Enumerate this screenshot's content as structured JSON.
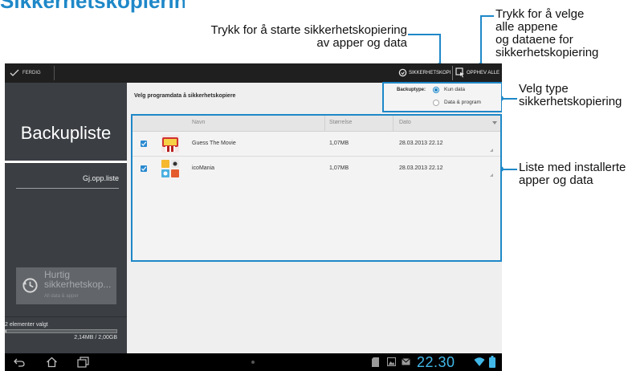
{
  "page": {
    "heading_fragment": "Sikkerhetskopiering"
  },
  "callouts": {
    "start_backup": [
      "Trykk for å starte sikkerhetskopiering",
      "av apper og data"
    ],
    "select_all": [
      "Trykk for å velge",
      "alle appene",
      "og dataene for",
      "sikkerhetskopiering"
    ],
    "backup_type": [
      "Velg type",
      "sikkerhetskopiering"
    ],
    "app_list": [
      "Liste med installerte",
      "apper og data"
    ]
  },
  "actionbar": {
    "done_label": "FERDIG",
    "backup_label": "SIKKERHETSKOPI",
    "deselect_label": "OPPHEV ALLE"
  },
  "sidebar": {
    "title": "Backupliste",
    "restore_link": "Gj.opp.liste",
    "quick_backup_title_1": "Hurtig",
    "quick_backup_title_2": "sikkerhetskop...",
    "quick_backup_sub": "All data & apper",
    "selected_count": "2 elementer valgt",
    "storage": "2,14MB / 2,00GB",
    "storage_fraction": 0.01
  },
  "content": {
    "instruction": "Velg programdata å sikkerhetskopiere",
    "backup_type_label": "Backuptype:",
    "options": [
      "Kun data",
      "Data & program"
    ],
    "selected_option": 0,
    "columns": [
      "Navn",
      "Størrelse",
      "Dato"
    ],
    "rows": [
      {
        "name": "Guess The Movie",
        "size": "1,07MB",
        "date": "28.03.2013 22.12",
        "checked": true
      },
      {
        "name": "icoMania",
        "size": "1,07MB",
        "date": "28.03.2013 22.12",
        "checked": true
      }
    ]
  },
  "statusbar": {
    "time": "22.30"
  },
  "colors": {
    "accent": "#1e88c8",
    "checkbox": "#2a8ad0",
    "time": "#41b8e8"
  }
}
